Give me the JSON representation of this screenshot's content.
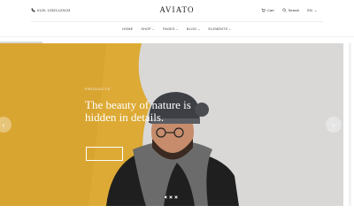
{
  "topbar": {
    "phone": "0129- 12323-123123",
    "logo": "AVIATO",
    "cart_label": "Cart",
    "search_label": "Search",
    "language": "EN"
  },
  "nav": {
    "items": [
      {
        "label": "HOME",
        "has_dropdown": false
      },
      {
        "label": "SHOP",
        "has_dropdown": true
      },
      {
        "label": "PAGES",
        "has_dropdown": true
      },
      {
        "label": "BLOG",
        "has_dropdown": true
      },
      {
        "label": "ELEMENTS",
        "has_dropdown": true
      }
    ]
  },
  "hero": {
    "eyebrow": "PRODUCTS",
    "headline": "The beauty of nature is hidden in details.",
    "cta_label": "",
    "arrow_left": "‹",
    "arrow_right": "›",
    "slides": 3,
    "active_slide": 1
  },
  "colors": {
    "yellow_wall": "#f0b93a",
    "white_wall": "#ecebea",
    "text_dark": "#222222"
  }
}
